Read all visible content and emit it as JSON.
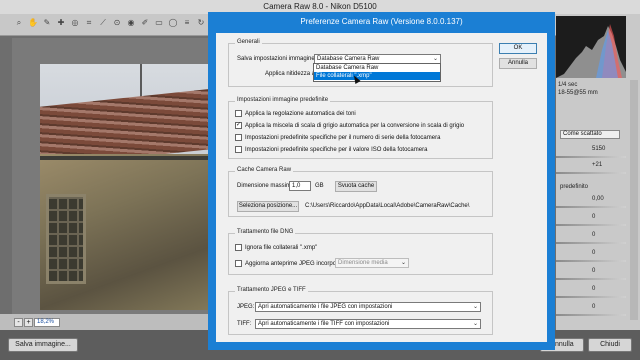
{
  "camera_raw": {
    "title": "Camera Raw 8.0  -  Nikon D5100",
    "zoom_value": "18,2%",
    "zoom_minus": "-",
    "zoom_plus": "+",
    "save_image_label": "Salva immagine...",
    "right_panel": {
      "info_shutter": "1/4 sec",
      "info_lens": "18-55@55 mm",
      "white_balance": "Come scattato",
      "temperature": "5150",
      "tint": "+21",
      "auto_label": "predefinito",
      "values": [
        "0,00",
        "0",
        "0",
        "0",
        "0",
        "0",
        "0",
        "0",
        "0"
      ]
    },
    "bottom_buttons": [
      "Annulla",
      "Chiudi"
    ]
  },
  "dialog": {
    "title": "Preferenze Camera Raw  (Versione 8.0.0.137)",
    "ok_label": "OK",
    "cancel_label": "Annulla",
    "general": {
      "title": "Generali",
      "save_settings_label": "Salva impostazioni immagine in:",
      "save_settings_value": "Database Camera Raw",
      "sharpening_label": "Applica nitidezza a:",
      "dropdown_options": [
        "Database Camera Raw",
        "File collaterali \".xmp\""
      ]
    },
    "defaults": {
      "title": "Impostazioni immagine predefinite",
      "options": [
        {
          "label": "Applica la regolazione automatica dei toni",
          "checked": false
        },
        {
          "label": "Applica la miscela di scala di grigio automatica per la conversione in scala di grigio",
          "checked": true
        },
        {
          "label": "Impostazioni predefinite specifiche per il numero di serie della fotocamera",
          "checked": false
        },
        {
          "label": "Impostazioni predefinite specifiche per il valore ISO della fotocamera",
          "checked": false
        }
      ]
    },
    "cache": {
      "title": "Cache Camera Raw",
      "max_size_label": "Dimensione massima:",
      "max_size_value": "1,0",
      "unit": "GB",
      "purge_label": "Svuota cache",
      "select_location_label": "Seleziona posizione...",
      "path": "C:\\Users\\Riccardo\\AppData\\Local\\Adobe\\CameraRaw\\Cache\\"
    },
    "dng": {
      "title": "Trattamento file DNG",
      "ignore_xmp_label": "Ignora file collaterali \".xmp\"",
      "update_previews_label": "Aggiorna anteprime JPEG incorporate:",
      "preview_size_value": "Dimensione media"
    },
    "jpeg_tiff": {
      "title": "Trattamento JPEG e TIFF",
      "jpeg_label": "JPEG:",
      "jpeg_value": "Apri automaticamente i file JPEG con impostazioni",
      "tiff_label": "TIFF:",
      "tiff_value": "Apri automaticamente i file TIFF con impostazioni"
    }
  }
}
